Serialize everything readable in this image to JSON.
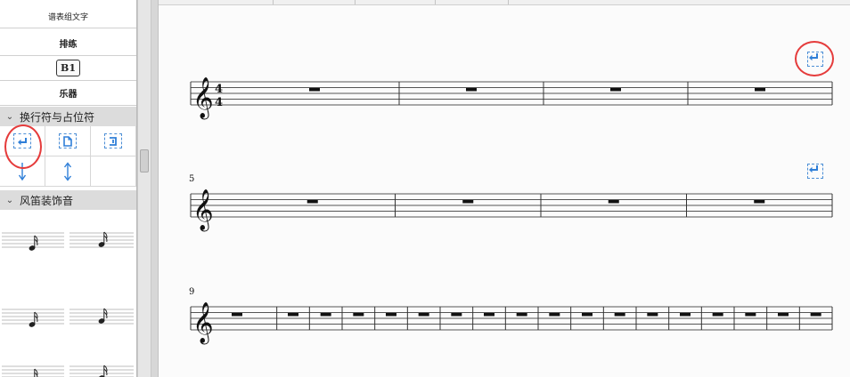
{
  "palette": {
    "rows": [
      {
        "label": "谱表组文字"
      },
      {
        "label": "排练"
      },
      {
        "label": "B1"
      },
      {
        "label": "乐器"
      }
    ],
    "sections": [
      {
        "title": "换行符与占位符",
        "expanded": true
      },
      {
        "title": "风笛装饰音",
        "expanded": true
      }
    ],
    "break_icons": [
      {
        "icon": "system-break-icon"
      },
      {
        "icon": "page-break-icon"
      },
      {
        "icon": "frame-break-icon"
      },
      {
        "icon": "staff-spacer-down-icon"
      },
      {
        "icon": "staff-spacer-icon"
      },
      {
        "icon": "empty"
      }
    ],
    "accent_color": "#2f7fd8",
    "annotation_color": "#e53b3b"
  },
  "score": {
    "clef": "treble",
    "time_signature": {
      "top": "4",
      "bottom": "4"
    },
    "systems": [
      {
        "measure_number": "",
        "measures": 4,
        "break_icon": true
      },
      {
        "measure_number": "5",
        "measures": 4,
        "break_icon": true
      },
      {
        "measure_number": "9",
        "measures": 18,
        "break_icon": false
      }
    ]
  }
}
